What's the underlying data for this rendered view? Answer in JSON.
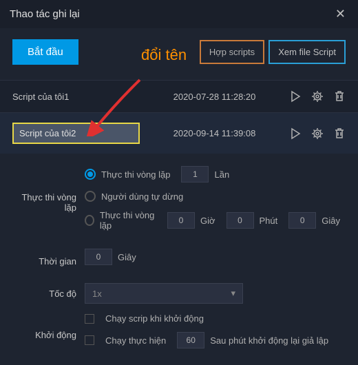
{
  "titlebar": {
    "title": "Thao tác ghi lại"
  },
  "top": {
    "start": "Bắt đầu",
    "rename_label": "đổi tên",
    "merge": "Hợp scripts",
    "view": "Xem file Script"
  },
  "scripts": [
    {
      "name": "Script của tôi1",
      "date": "2020-07-28 11:28:20"
    },
    {
      "name": "Script của tôi2",
      "date": "2020-09-14 11:39:08"
    }
  ],
  "settings": {
    "loop_label": "Thực thi vòng lặp",
    "loop_opt1": "Thực thi vòng lặp",
    "loop_count": "1",
    "loop_unit": "Lần",
    "loop_opt2": "Người dùng tự dừng",
    "loop_opt3": "Thực thi vòng lặp",
    "hours_val": "0",
    "hours_lbl": "Giờ",
    "mins_val": "0",
    "mins_lbl": "Phút",
    "secs_val": "0",
    "secs_lbl": "Giây",
    "time_label": "Thời gian",
    "time_val": "0",
    "time_unit": "Giây",
    "speed_label": "Tốc độ",
    "speed_val": "1x",
    "startup_label": "Khởi động",
    "startup_opt1": "Chạy scrip khi khởi động",
    "startup_opt2a": "Chạy thực hiện",
    "startup_opt2_val": "60",
    "startup_opt2b": "Sau phút khởi động lại giả lập"
  }
}
